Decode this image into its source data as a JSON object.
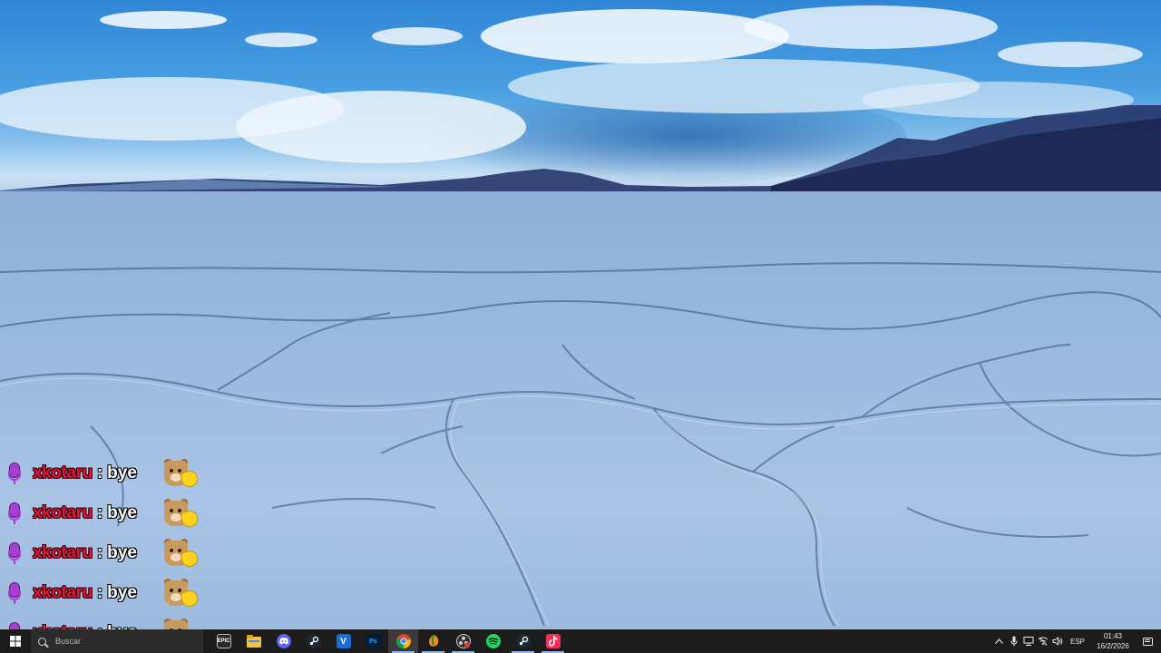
{
  "chat": {
    "messages": [
      {
        "username": "xkotaru",
        "separator": ":",
        "text": "bye",
        "emote": "hamster-emote"
      },
      {
        "username": "xkotaru",
        "separator": ":",
        "text": "bye",
        "emote": "hamster-emote"
      },
      {
        "username": "xkotaru",
        "separator": ":",
        "text": "bye",
        "emote": "hamster-emote"
      },
      {
        "username": "xkotaru",
        "separator": ":",
        "text": "bye",
        "emote": "hamster-emote"
      },
      {
        "username": "xkotaru",
        "separator": ":",
        "text": "bye",
        "emote": "hamster-emote"
      }
    ],
    "username_color": "#e2143a",
    "badge_icon": "microphone-icon",
    "badge_color": "#a83fd3"
  },
  "taskbar": {
    "search_placeholder": "Buscar",
    "apps": [
      {
        "name": "epic-games-icon",
        "label": "EPIC"
      },
      {
        "name": "file-explorer-icon",
        "label": ""
      },
      {
        "name": "discord-icon",
        "label": ""
      },
      {
        "name": "steam-icon",
        "label": ""
      },
      {
        "name": "vegas-icon",
        "label": "V"
      },
      {
        "name": "photoshop-icon",
        "label": "Ps"
      },
      {
        "name": "chrome-icon",
        "label": ""
      },
      {
        "name": "fl-studio-icon",
        "label": ""
      },
      {
        "name": "obs-icon",
        "label": ""
      },
      {
        "name": "spotify-icon",
        "label": ""
      },
      {
        "name": "steam-icon-2",
        "label": ""
      },
      {
        "name": "tiktok-icon",
        "label": ""
      }
    ],
    "tray": {
      "language": "ESP",
      "time": "01:43",
      "date": "16/2/2026"
    }
  }
}
